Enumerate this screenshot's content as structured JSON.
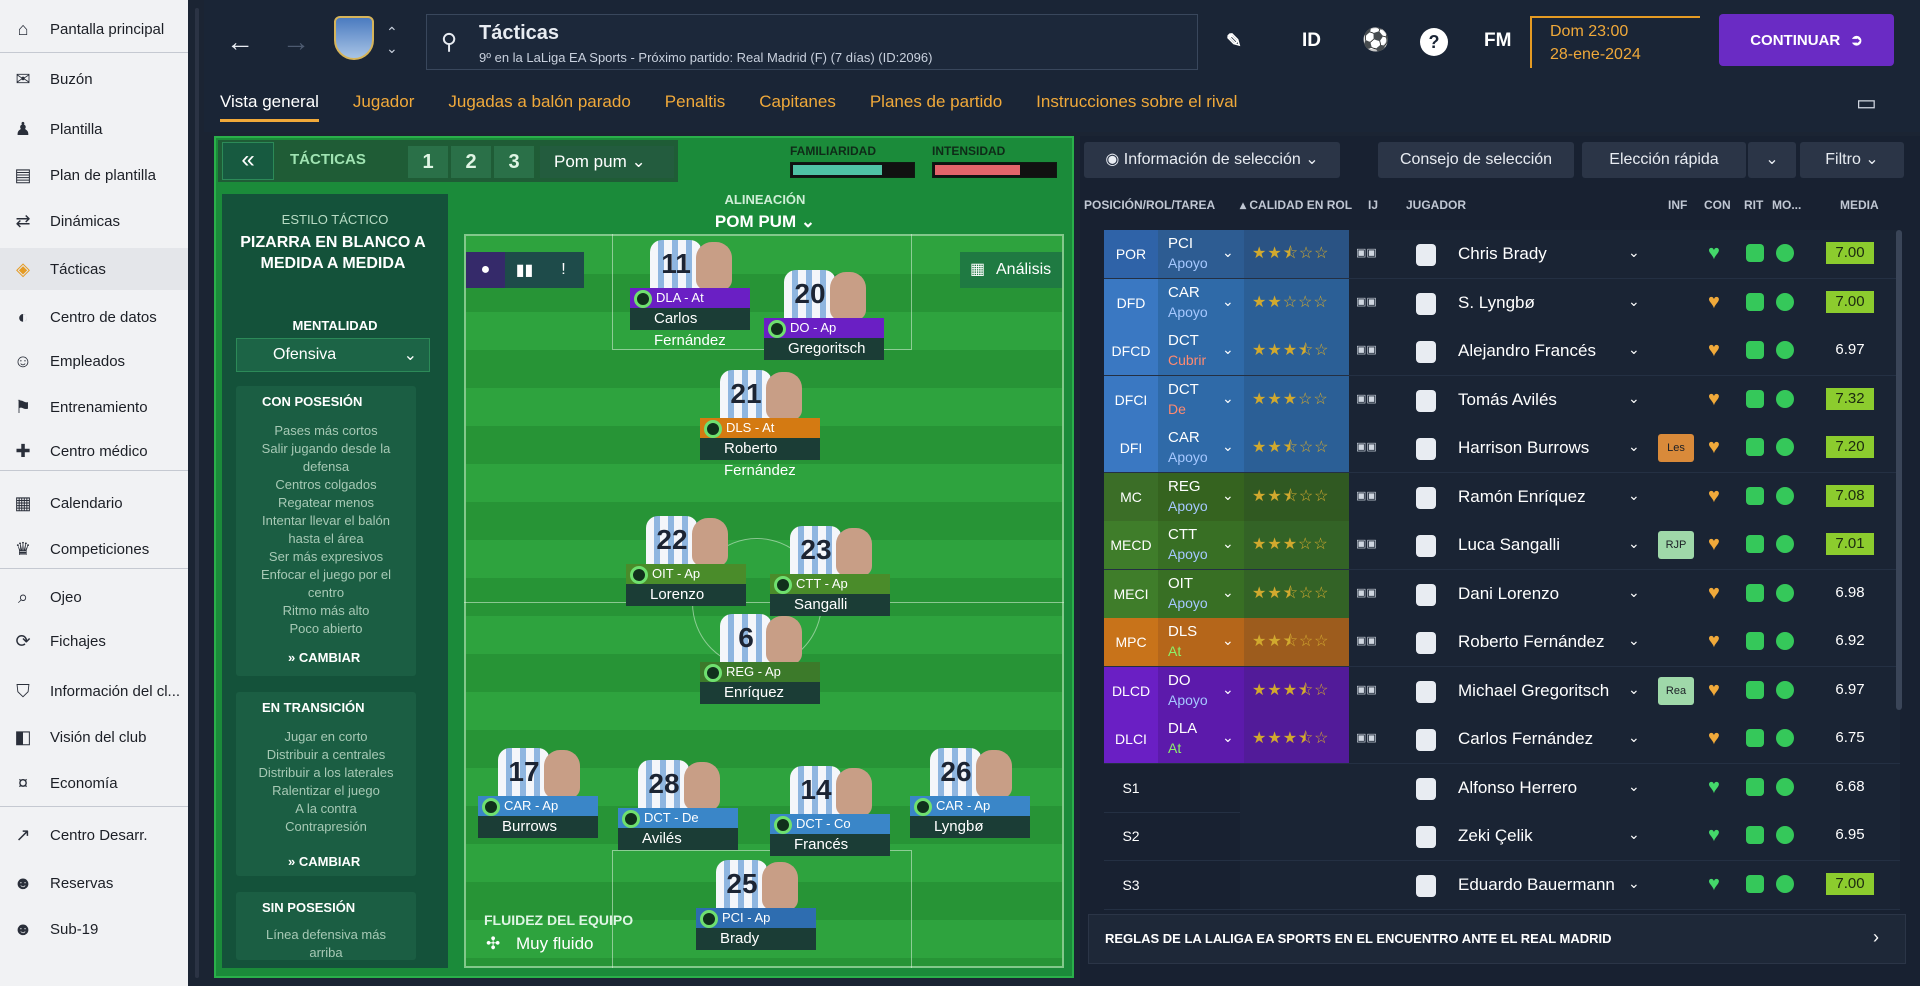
{
  "sidebar": {
    "items": [
      {
        "label": "Pantalla principal",
        "icon": "home-icon"
      },
      {
        "label": "Buzón",
        "icon": "inbox-icon"
      },
      {
        "label": "Plantilla",
        "icon": "squad-icon"
      },
      {
        "label": "Plan de plantilla",
        "icon": "clipboard-icon"
      },
      {
        "label": "Dinámicas",
        "icon": "dynamics-icon"
      },
      {
        "label": "Tácticas",
        "icon": "tactics-icon"
      },
      {
        "label": "Centro de datos",
        "icon": "data-hub-icon"
      },
      {
        "label": "Empleados",
        "icon": "staff-icon"
      },
      {
        "label": "Entrenamiento",
        "icon": "training-icon"
      },
      {
        "label": "Centro médico",
        "icon": "medical-icon"
      },
      {
        "label": "Calendario",
        "icon": "calendar-icon"
      },
      {
        "label": "Competiciones",
        "icon": "trophy-icon"
      },
      {
        "label": "Ojeo",
        "icon": "scouting-icon"
      },
      {
        "label": "Fichajes",
        "icon": "transfers-icon"
      },
      {
        "label": "Información del cl...",
        "icon": "club-info-icon"
      },
      {
        "label": "Visión del club",
        "icon": "club-vision-icon"
      },
      {
        "label": "Economía",
        "icon": "finances-icon"
      },
      {
        "label": "Centro Desarr.",
        "icon": "development-icon"
      },
      {
        "label": "Reservas",
        "icon": "reserves-icon"
      },
      {
        "label": "Sub-19",
        "icon": "u19-icon"
      }
    ],
    "active": "Tácticas"
  },
  "header": {
    "title": "Tácticas",
    "subtitle": "9º en la LaLiga EA Sports - Próximo partido: Real Madrid (F) (7 días) (ID:2096)",
    "id_label": "ID",
    "fm_label": "FM",
    "help_label": "?",
    "date_line1": "Dom 23:00",
    "date_line2": "28-ene-2024",
    "continue_label": "CONTINUAR"
  },
  "tabs": [
    "Vista general",
    "Jugador",
    "Jugadas a balón parado",
    "Penaltis",
    "Capitanes",
    "Planes de partido",
    "Instrucciones sobre el rival"
  ],
  "active_tab": "Vista general",
  "tactics_bar": {
    "title": "TÁCTICAS",
    "slots": [
      "1",
      "2",
      "3"
    ],
    "tactic_name": "Pom pum",
    "familiarity_label": "FAMILIARIDAD",
    "familiarity_level": 0.75,
    "intensity_label": "INTENSIDAD",
    "intensity_level": 0.72
  },
  "style_panel": {
    "style_label": "ESTILO TÁCTICO",
    "style_value": "PIZARRA EN BLANCO A MEDIDA A MEDIDA",
    "mentality_label": "MENTALIDAD",
    "mentality_value": "Ofensiva",
    "in_possession": {
      "title": "CON POSESIÓN",
      "lines": [
        "Pases más cortos",
        "Salir jugando desde la",
        "defensa",
        "Centros colgados",
        "Regatear menos",
        "Intentar llevar el balón",
        "hasta el área",
        "Ser más expresivos",
        "Enfocar el juego por el",
        "centro",
        "Ritmo más alto",
        "Poco abierto"
      ],
      "change": "CAMBIAR"
    },
    "in_transition": {
      "title": "EN TRANSICIÓN",
      "lines": [
        "Jugar en corto",
        "Distribuir a centrales",
        "Distribuir a los laterales",
        "Ralentizar el juego",
        "A la contra",
        "Contrapresión"
      ],
      "change": "CAMBIAR"
    },
    "out_possession": {
      "title": "SIN POSESIÓN",
      "lines": [
        "Línea defensiva más",
        "arriba"
      ]
    }
  },
  "pitch": {
    "lineup_label": "ALINEACIÓN",
    "lineup_name": "POM PUM",
    "analysis_label": "Análisis",
    "fluidity_label": "FLUIDEZ DEL EQUIPO",
    "fluidity_value": "Muy fluido",
    "players": [
      {
        "num": "11",
        "role": "DLA - At",
        "name": "Carlos Fernández",
        "color": "#6a1fc4"
      },
      {
        "num": "20",
        "role": "DO - Ap",
        "name": "Gregoritsch",
        "color": "#6a1fc4"
      },
      {
        "num": "21",
        "role": "DLS - At",
        "name": "Roberto Fernández",
        "color": "#d47a12"
      },
      {
        "num": "22",
        "role": "OIT - Ap",
        "name": "Lorenzo",
        "color": "#4a8c2a"
      },
      {
        "num": "23",
        "role": "CTT - Ap",
        "name": "Sangalli",
        "color": "#4a8c2a"
      },
      {
        "num": "6",
        "role": "REG - Ap",
        "name": "Enríquez",
        "color": "#3c7a2a"
      },
      {
        "num": "17",
        "role": "CAR - Ap",
        "name": "Burrows",
        "color": "#3a86c8"
      },
      {
        "num": "28",
        "role": "DCT - De",
        "name": "Avilés",
        "color": "#3a86c8"
      },
      {
        "num": "14",
        "role": "DCT - Co",
        "name": "Francés",
        "color": "#3a86c8"
      },
      {
        "num": "26",
        "role": "CAR - Ap",
        "name": "Lyngbø",
        "color": "#3a86c8"
      },
      {
        "num": "25",
        "role": "PCI - Ap",
        "name": "Brady",
        "color": "#2e6db0"
      }
    ]
  },
  "selection": {
    "info_label": "Información de selección",
    "advice_label": "Consejo de selección",
    "quick_label": "Elección rápida",
    "filter_label": "Filtro",
    "columns": {
      "pos": "POSICIÓN/ROL/TAREA",
      "quality": "CALIDAD EN ROL",
      "ij": "IJ",
      "player": "JUGADOR",
      "inf": "INF",
      "con": "CON",
      "rit": "RIT",
      "mo": "MO...",
      "media": "MEDIA"
    },
    "rows": [
      {
        "pos": "POR",
        "role": "PCI",
        "duty": "Apoyo",
        "stars": 2.5,
        "player": "Chris Brady",
        "inf": "",
        "media": "7.00",
        "pcolor": "#2f63a8",
        "rcolor": "#2d5c92"
      },
      {
        "pos": "DFD",
        "role": "CAR",
        "duty": "Apoyo",
        "stars": 2,
        "player": "S. Lyngbø",
        "inf": "",
        "media": "7.00",
        "pcolor": "#3a78c2",
        "rcolor": "#2f6aa8"
      },
      {
        "pos": "DFCD",
        "role": "DCT",
        "duty": "Cubrir",
        "stars": 3.5,
        "player": "Alejandro Francés",
        "inf": "",
        "media": "6.97",
        "pcolor": "#3a78c2",
        "rcolor": "#2f6aa8"
      },
      {
        "pos": "DFCI",
        "role": "DCT",
        "duty": "De",
        "stars": 3,
        "player": "Tomás Avilés",
        "inf": "",
        "media": "7.32",
        "pcolor": "#3a78c2",
        "rcolor": "#2f6aa8"
      },
      {
        "pos": "DFI",
        "role": "CAR",
        "duty": "Apoyo",
        "stars": 2.5,
        "player": "Harrison Burrows",
        "inf": "Les",
        "media": "7.20",
        "pcolor": "#3a78c2",
        "rcolor": "#2f6aa8"
      },
      {
        "pos": "MC",
        "role": "REG",
        "duty": "Apoyo",
        "stars": 2.5,
        "player": "Ramón Enríquez",
        "inf": "",
        "media": "7.08",
        "pcolor": "#3b6e27",
        "rcolor": "#35631f"
      },
      {
        "pos": "MECD",
        "role": "CTT",
        "duty": "Apoyo",
        "stars": 3,
        "player": "Luca Sangalli",
        "inf": "RJP",
        "media": "7.01",
        "pcolor": "#3f7d2a",
        "rcolor": "#386f24"
      },
      {
        "pos": "MECI",
        "role": "OIT",
        "duty": "Apoyo",
        "stars": 2.5,
        "player": "Dani Lorenzo",
        "inf": "",
        "media": "6.98",
        "pcolor": "#3f7d2a",
        "rcolor": "#386f24"
      },
      {
        "pos": "MPC",
        "role": "DLS",
        "duty": "At",
        "stars": 2.5,
        "player": "Roberto Fernández",
        "inf": "",
        "media": "6.92",
        "pcolor": "#c8731a",
        "rcolor": "#b5661a"
      },
      {
        "pos": "DLCD",
        "role": "DO",
        "duty": "Apoyo",
        "stars": 3.5,
        "player": "Michael Gregoritsch",
        "inf": "Rea",
        "media": "6.97",
        "pcolor": "#6a1fc4",
        "rcolor": "#5c1aab"
      },
      {
        "pos": "DLCI",
        "role": "DLA",
        "duty": "At",
        "stars": 3.5,
        "player": "Carlos Fernández",
        "inf": "",
        "media": "6.75",
        "pcolor": "#6a1fc4",
        "rcolor": "#5c1aab"
      },
      {
        "pos": "S1",
        "role": "",
        "duty": "",
        "stars": 0,
        "player": "Alfonso Herrero",
        "inf": "",
        "media": "6.68",
        "pcolor": "",
        "rcolor": ""
      },
      {
        "pos": "S2",
        "role": "",
        "duty": "",
        "stars": 0,
        "player": "Zeki Çelik",
        "inf": "",
        "media": "6.95",
        "pcolor": "",
        "rcolor": ""
      },
      {
        "pos": "S3",
        "role": "",
        "duty": "",
        "stars": 0,
        "player": "Eduardo Bauermann",
        "inf": "",
        "media": "7.00",
        "pcolor": "",
        "rcolor": ""
      }
    ],
    "footer": "REGLAS DE LA LALIGA EA SPORTS EN EL ENCUENTRO ANTE EL REAL MADRID"
  }
}
